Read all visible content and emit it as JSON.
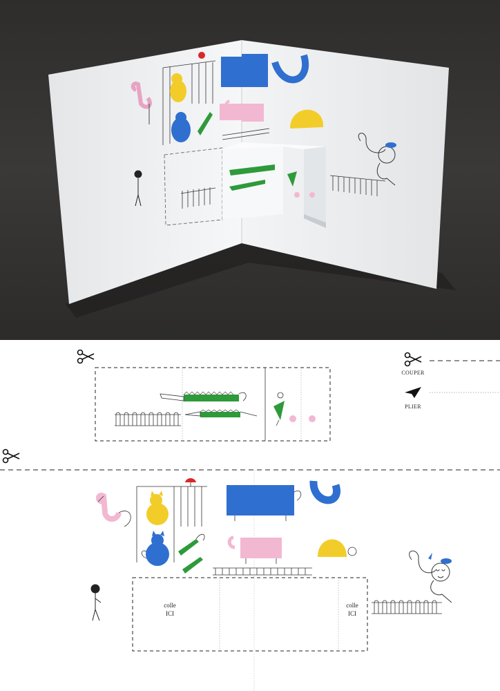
{
  "legend": {
    "cut_label": "COUPER",
    "fold_label": "PLIER"
  },
  "glue_zones": {
    "left": {
      "line1": "colle",
      "line2": "ICI"
    },
    "right": {
      "line1": "colle",
      "line2": "ICI"
    }
  },
  "icons": {
    "cut": "scissors-icon",
    "fold": "paper-plane-icon"
  },
  "colors": {
    "blue": "#2f6fd0",
    "yellow": "#f2cd2a",
    "pink": "#f2b8d2",
    "green": "#2e9a3a",
    "red": "#d8282a",
    "background_photo": "#2a2a28"
  }
}
